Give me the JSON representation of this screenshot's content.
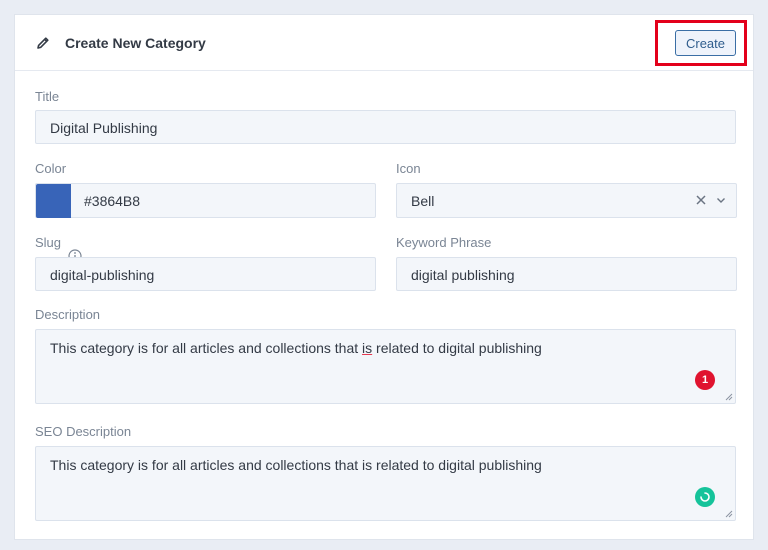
{
  "header": {
    "title": "Create New Category",
    "create_label": "Create"
  },
  "form": {
    "title": {
      "label": "Title",
      "value": "Digital Publishing"
    },
    "color": {
      "label": "Color",
      "value": "#3864B8",
      "swatch": "#3864B8"
    },
    "icon": {
      "label": "Icon",
      "value": "Bell"
    },
    "slug": {
      "label": "Slug",
      "value": "digital-publishing"
    },
    "keyword": {
      "label": "Keyword Phrase",
      "value": "digital publishing"
    },
    "description": {
      "label": "Description",
      "text_before": "This category is for all articles and collections that ",
      "text_misspelled": "is",
      "text_after": " related to digital publishing",
      "badge": "1"
    },
    "seo_description": {
      "label": "SEO Description",
      "value": "This category is for all articles and collections that is related to digital publishing"
    }
  },
  "colors": {
    "accent": "#3A6EA5",
    "highlight": "#E3001B",
    "error_badge": "#E0132F",
    "ok_badge": "#15C39A"
  }
}
